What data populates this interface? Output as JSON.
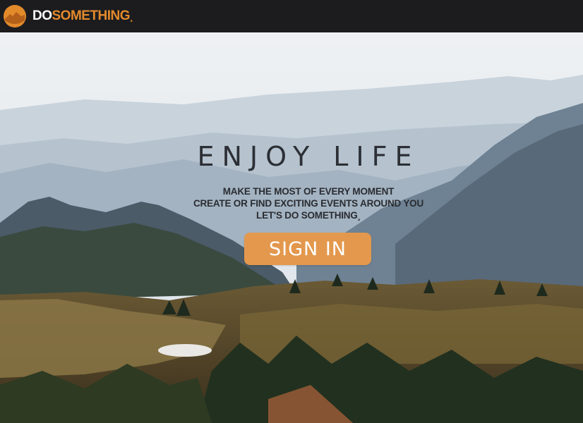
{
  "brand": {
    "prefix": "DO",
    "highlight": "SOMETHING",
    "tail": "¸",
    "accent_color": "#e38a2b"
  },
  "hero": {
    "headline": "ENJOY LIFE",
    "taglines": [
      "MAKE THE MOST OF EVERY MOMENT",
      "CREATE OR FIND EXCITING EVENTS AROUND YOU",
      "LET'S DO SOMETHING¸"
    ],
    "signin_label": "SIGN IN",
    "signin_color": "#e3984d",
    "background": "misty-mountain-landscape-photo"
  },
  "icons": {
    "logo": "orange-circle-mountain-logo"
  }
}
